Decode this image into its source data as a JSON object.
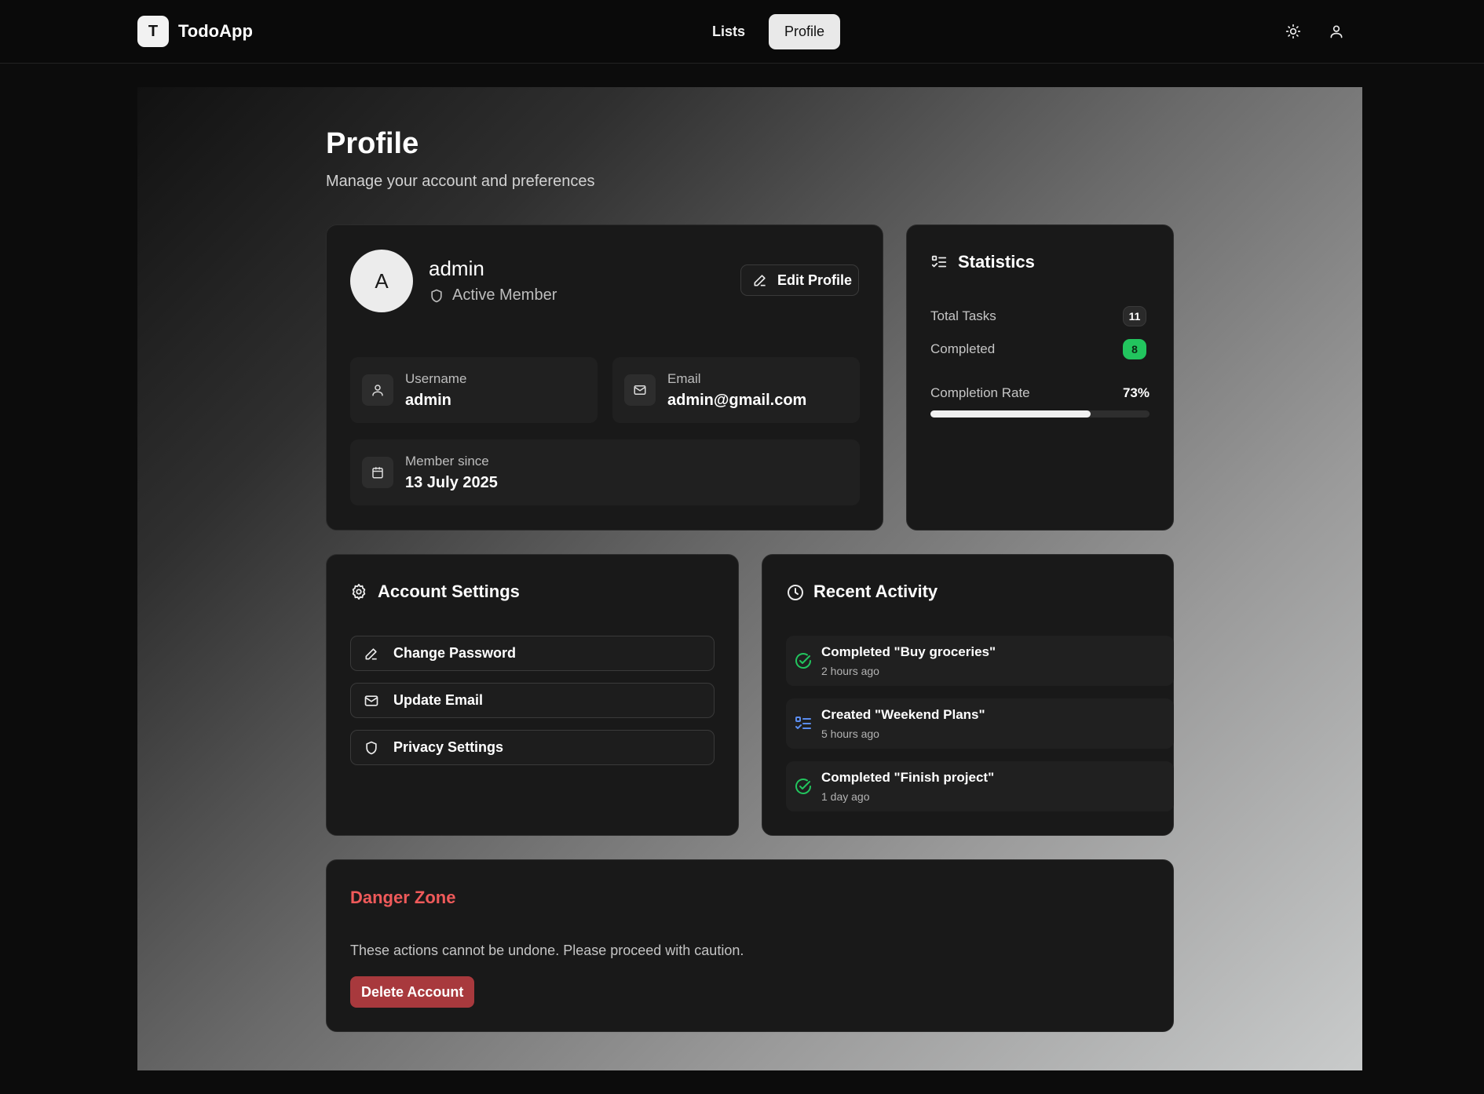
{
  "brand": {
    "logo_letter": "T",
    "name": "TodoApp"
  },
  "nav": {
    "tabs": [
      {
        "label": "Lists",
        "active": false
      },
      {
        "label": "Profile",
        "active": true
      }
    ]
  },
  "header_icons": [
    "sun-icon",
    "user-icon"
  ],
  "page": {
    "title": "Profile",
    "subtitle": "Manage your account and preferences"
  },
  "profile": {
    "avatar_letter": "A",
    "name": "admin",
    "status": "Active Member",
    "edit_label": "Edit Profile",
    "fields": {
      "username": {
        "label": "Username",
        "value": "admin"
      },
      "email": {
        "label": "Email",
        "value": "admin@gmail.com"
      },
      "member_since": {
        "label": "Member since",
        "value": "13 July 2025"
      }
    }
  },
  "statistics": {
    "title": "Statistics",
    "total_tasks": {
      "label": "Total Tasks",
      "value": "11"
    },
    "completed": {
      "label": "Completed",
      "value": "8"
    },
    "completion_rate": {
      "label": "Completion Rate",
      "value": "73%",
      "fraction": 0.73
    }
  },
  "account_settings": {
    "title": "Account Settings",
    "items": [
      {
        "label": "Change Password",
        "icon": "pencil-icon"
      },
      {
        "label": "Update Email",
        "icon": "mail-icon"
      },
      {
        "label": "Privacy Settings",
        "icon": "shield-icon"
      }
    ]
  },
  "recent_activity": {
    "title": "Recent Activity",
    "items": [
      {
        "title": "Completed \"Buy groceries\"",
        "time": "2 hours ago",
        "icon": "check-circle-icon"
      },
      {
        "title": "Created \"Weekend Plans\"",
        "time": "5 hours ago",
        "icon": "list-icon"
      },
      {
        "title": "Completed \"Finish project\"",
        "time": "1 day ago",
        "icon": "check-circle-icon"
      }
    ]
  },
  "danger_zone": {
    "title": "Danger Zone",
    "description": "These actions cannot be undone. Please proceed with caution.",
    "delete_label": "Delete Account"
  },
  "colors": {
    "accent_green": "#22c55e",
    "danger_red": "#ef5a5a",
    "delete_button": "#a8393d",
    "activity_blue": "#5b8def"
  }
}
